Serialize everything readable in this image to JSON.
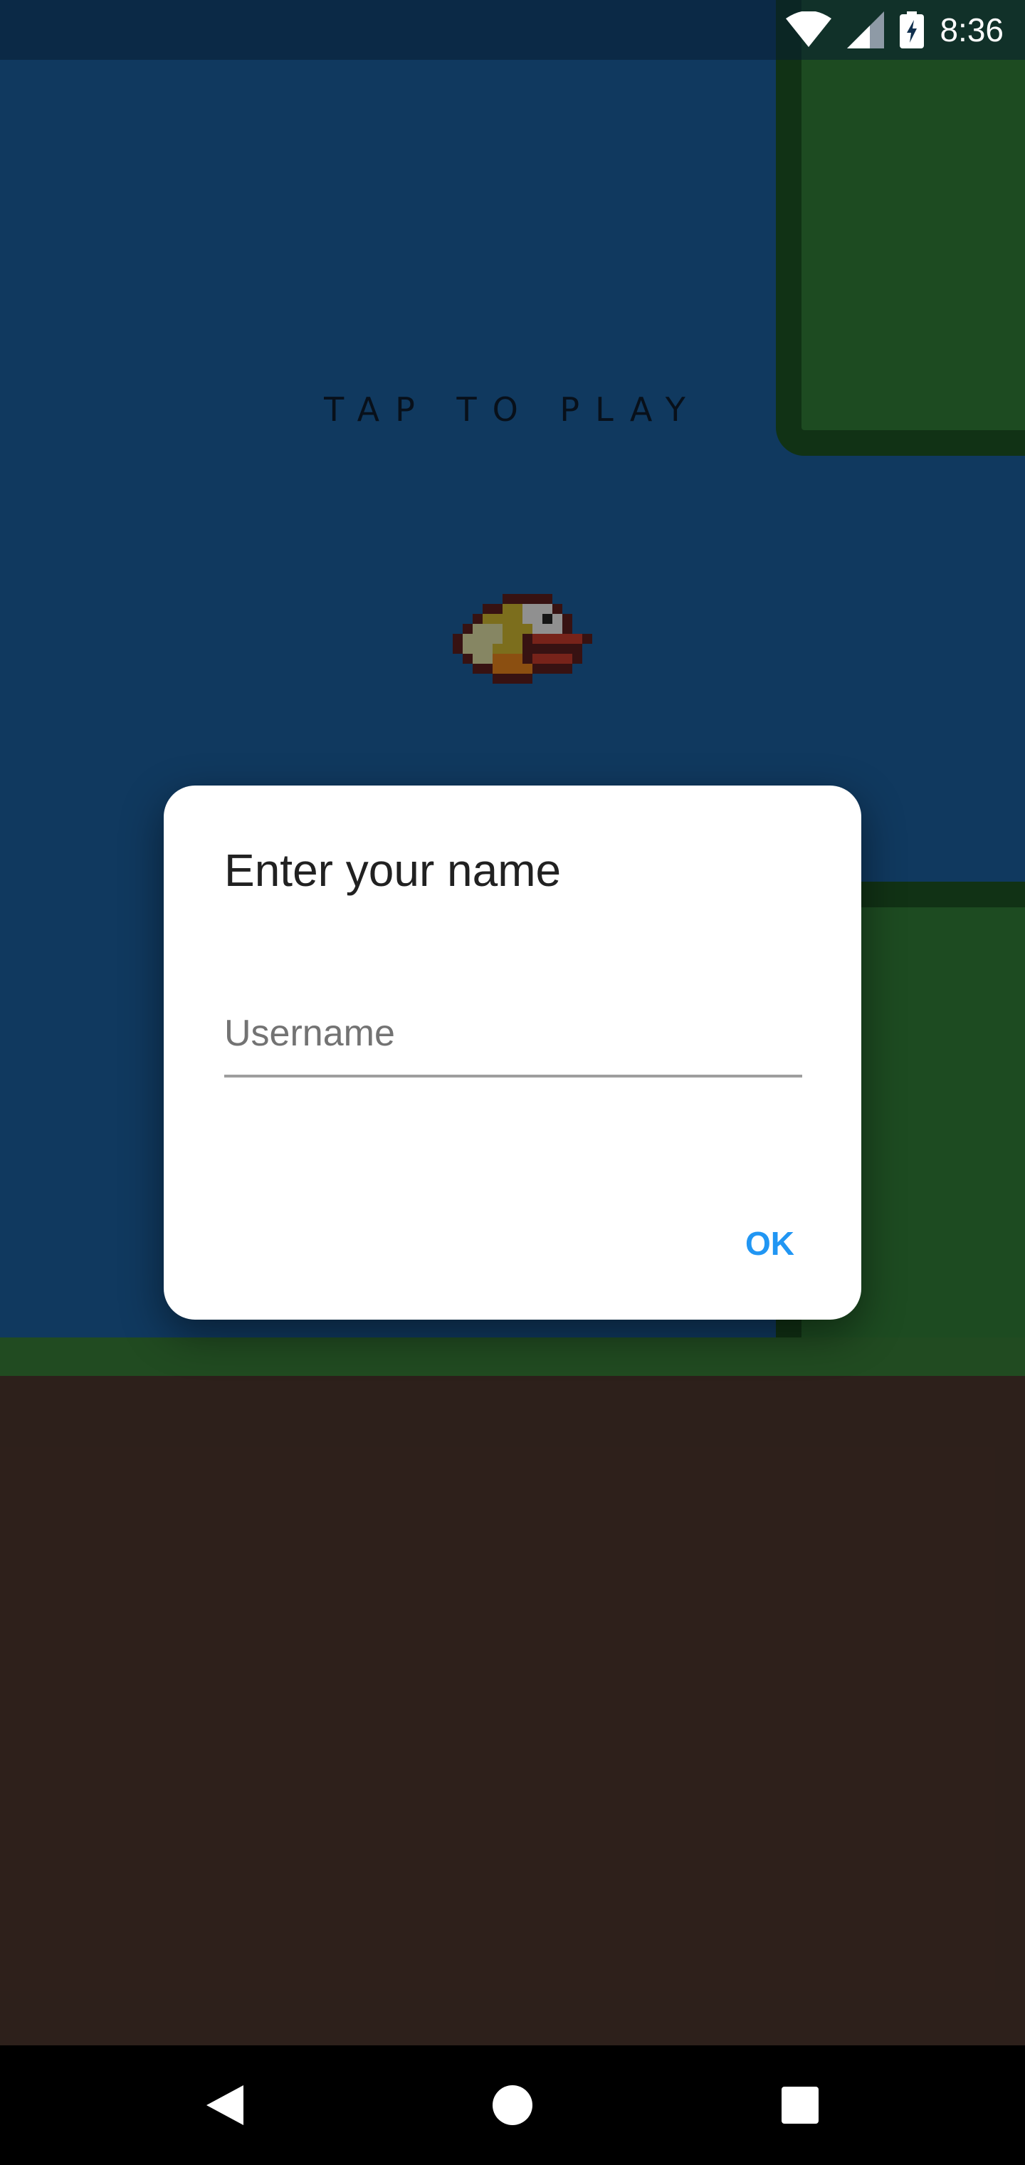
{
  "status_bar": {
    "time": "8:36",
    "icons": [
      "wifi-icon",
      "signal-icon",
      "battery-charging-icon"
    ]
  },
  "game": {
    "prompt": "TAP TO PLAY",
    "sprite": "bird-sprite",
    "colors": {
      "sky": "#1a5c99",
      "pipe": "#2f7a36",
      "pipe_border": "#1c5222",
      "ground": "#4a342c",
      "grass": "#367a36"
    }
  },
  "dialog": {
    "title": "Enter your name",
    "username_placeholder": "Username",
    "username_value": "",
    "ok_label": "OK",
    "accent": "#2196f3"
  },
  "nav_bar": {
    "buttons": [
      "back-icon",
      "home-icon",
      "recents-icon"
    ]
  }
}
